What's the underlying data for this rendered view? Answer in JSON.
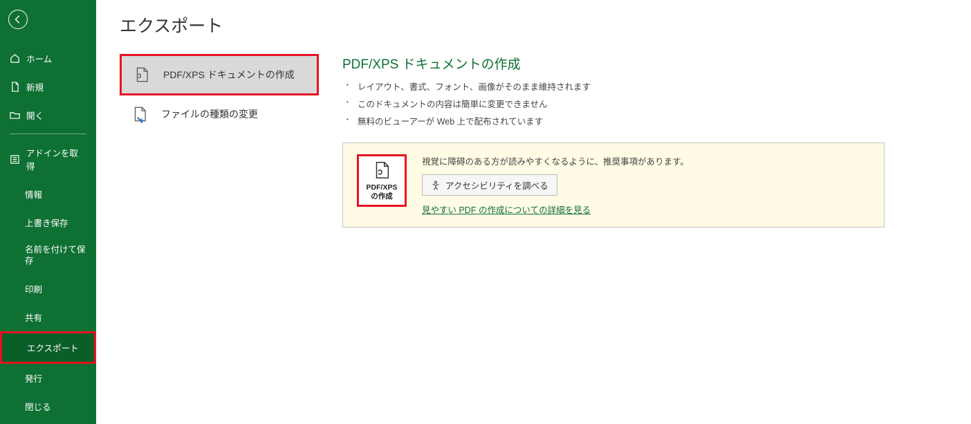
{
  "sidebar": {
    "home": "ホーム",
    "new": "新規",
    "open": "開く",
    "addins": "アドインを取得",
    "items": [
      "情報",
      "上書き保存",
      "名前を付けて保存",
      "印刷",
      "共有",
      "エクスポート",
      "発行",
      "閉じる"
    ]
  },
  "page_title": "エクスポート",
  "options": {
    "pdfxps": "PDF/XPS ドキュメントの作成",
    "change_type": "ファイルの種類の変更"
  },
  "detail": {
    "heading": "PDF/XPS ドキュメントの作成",
    "bullets": [
      "レイアウト、書式、フォント、画像がそのまま維持されます",
      "このドキュメントの内容は簡単に変更できません",
      "無料のビューアーが Web 上で配布されています"
    ]
  },
  "panel": {
    "create_label_line1": "PDF/XPS",
    "create_label_line2": "の作成",
    "note_text": "視覚に障碍のある方が読みやすくなるように、推奨事項があります。",
    "a11y_button": "アクセシビリティを調べる",
    "link": "見やすい PDF の作成についての詳細を見る"
  }
}
